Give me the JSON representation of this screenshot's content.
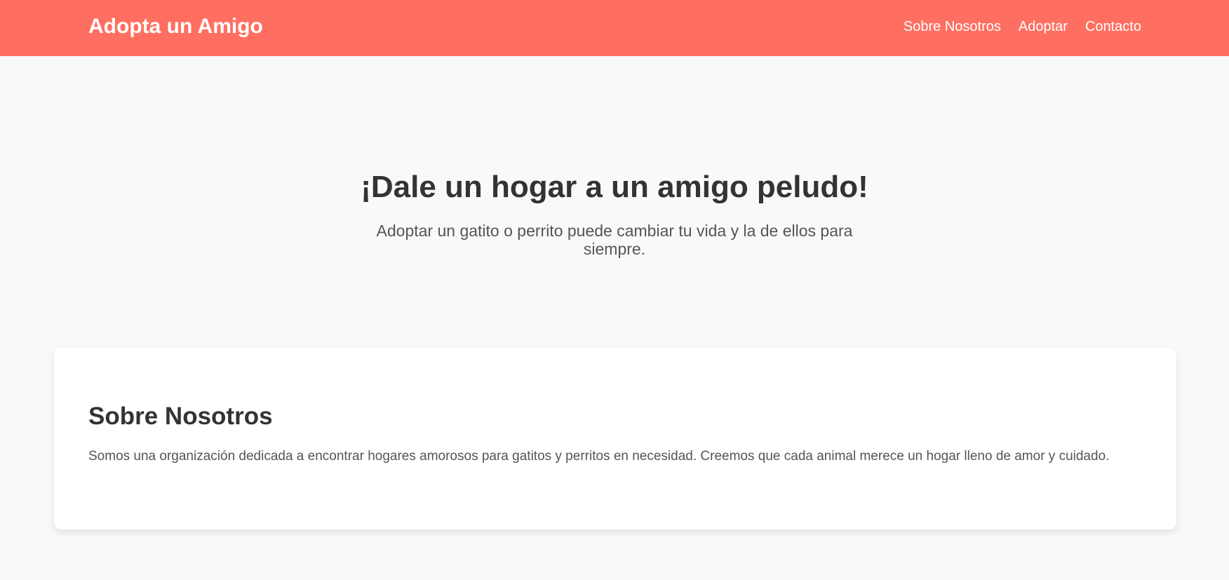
{
  "header": {
    "brand": "Adopta un Amigo",
    "nav": [
      {
        "label": "Sobre Nosotros"
      },
      {
        "label": "Adoptar"
      },
      {
        "label": "Contacto"
      }
    ]
  },
  "hero": {
    "title": "¡Dale un hogar a un amigo peludo!",
    "subtitle": "Adoptar un gatito o perrito puede cambiar tu vida y la de ellos para siempre."
  },
  "about": {
    "title": "Sobre Nosotros",
    "text": "Somos una organización dedicada a encontrar hogares amorosos para gatitos y perritos en necesidad. Creemos que cada animal merece un hogar lleno de amor y cuidado."
  },
  "colors": {
    "header_bg": "#ff6f61",
    "page_bg": "#f9f9f9",
    "card_bg": "#ffffff",
    "heading_text": "#333333",
    "body_text": "#555555"
  }
}
